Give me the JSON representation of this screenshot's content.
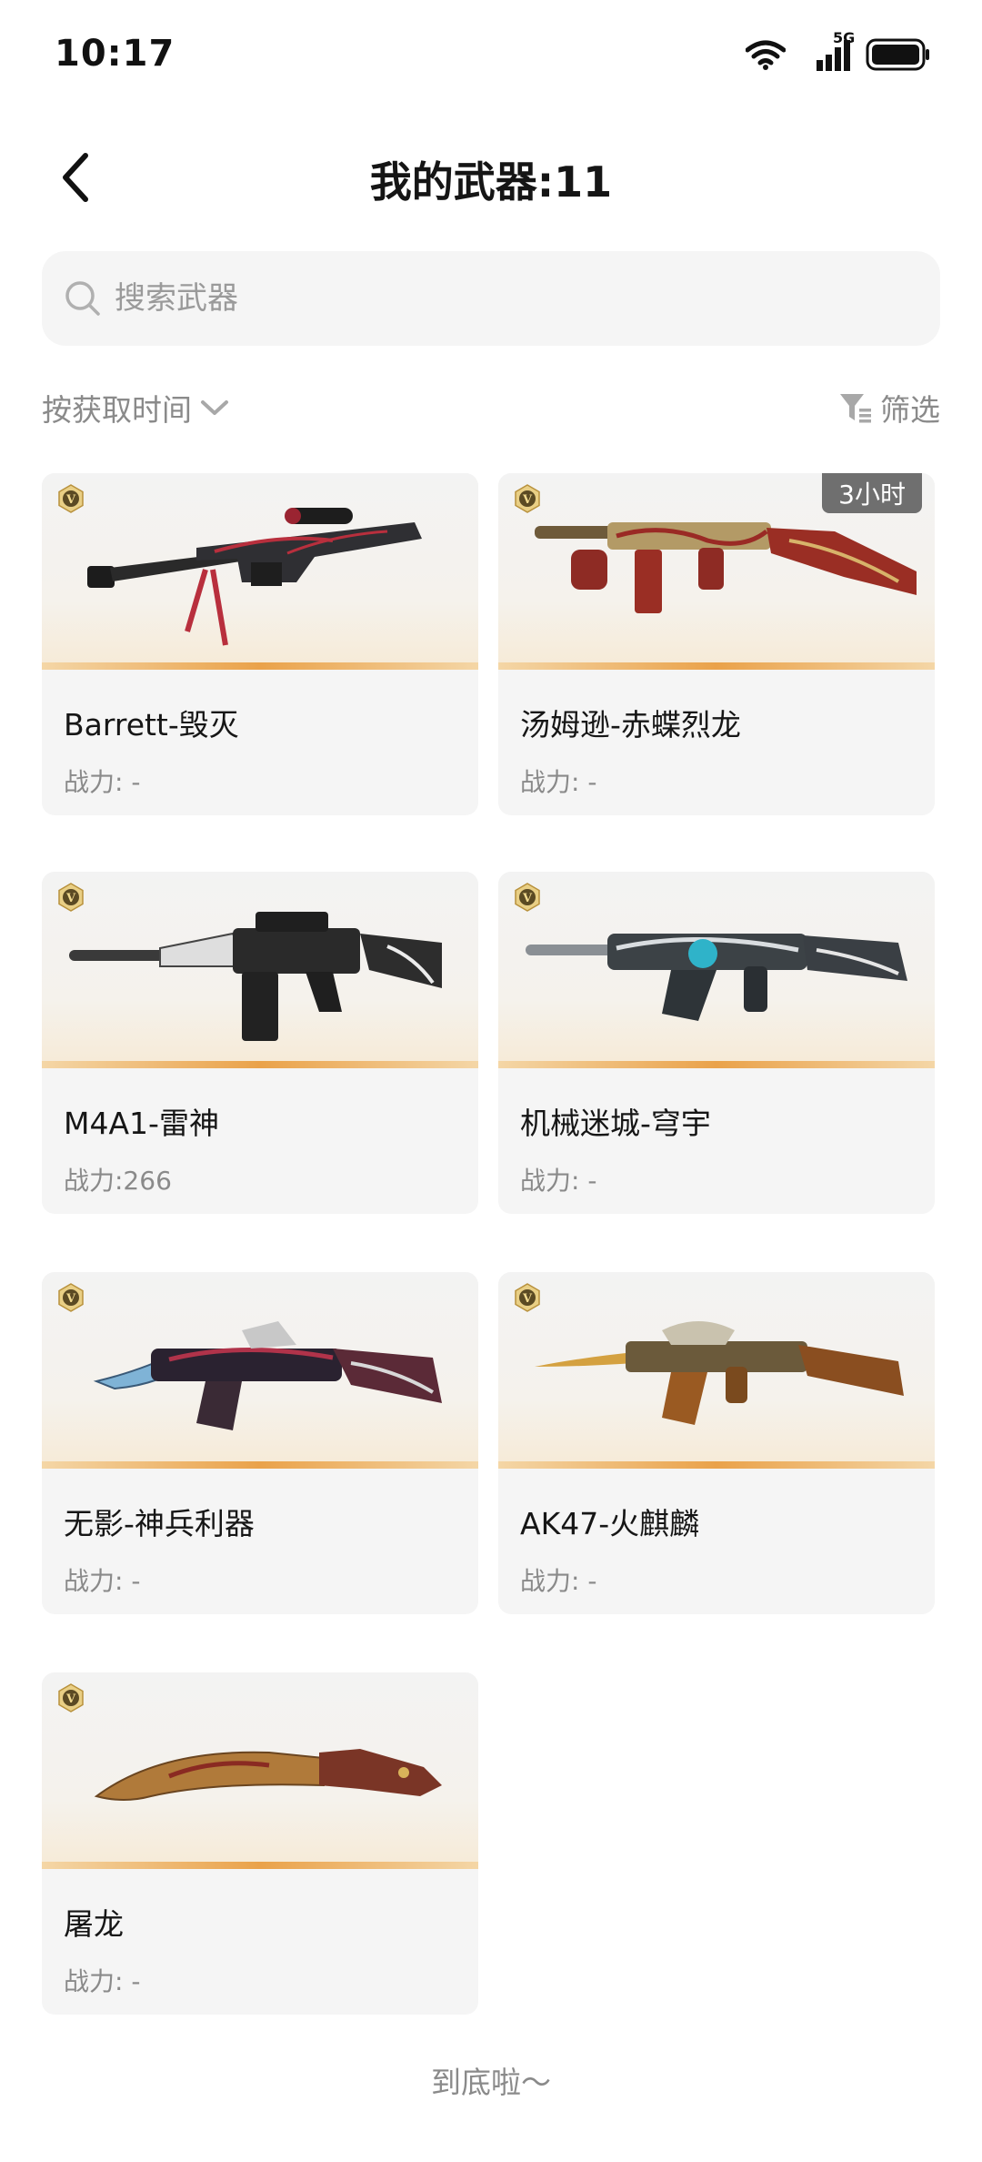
{
  "status_bar": {
    "time": "10:17",
    "network": "5G"
  },
  "header": {
    "title": "我的武器:11"
  },
  "search": {
    "placeholder": "搜索武器"
  },
  "toolbar": {
    "sort_label": "按获取时间",
    "filter_label": "筛选"
  },
  "weapons": [
    {
      "name": "Barrett-毁灭",
      "power": "战力: -",
      "badge": "V"
    },
    {
      "name": "汤姆逊-赤蝶烈龙",
      "power": "战力: -",
      "badge": "V",
      "time_tag": "3小时"
    },
    {
      "name": "M4A1-雷神",
      "power": "战力:266",
      "badge": "V"
    },
    {
      "name": "机械迷城-穹宇",
      "power": "战力: -",
      "badge": "V"
    },
    {
      "name": "无影-神兵利器",
      "power": "战力: -",
      "badge": "V"
    },
    {
      "name": "AK47-火麒麟",
      "power": "战力: -",
      "badge": "V"
    },
    {
      "name": "屠龙",
      "power": "战力: -",
      "badge": "V"
    }
  ],
  "footer": {
    "end_text": "到底啦～"
  },
  "colors": {
    "accent": "#eaa24a",
    "card_bg": "#f5f5f5",
    "muted_text": "#8a8a8a",
    "tag_bg": "#6f6f6f"
  }
}
